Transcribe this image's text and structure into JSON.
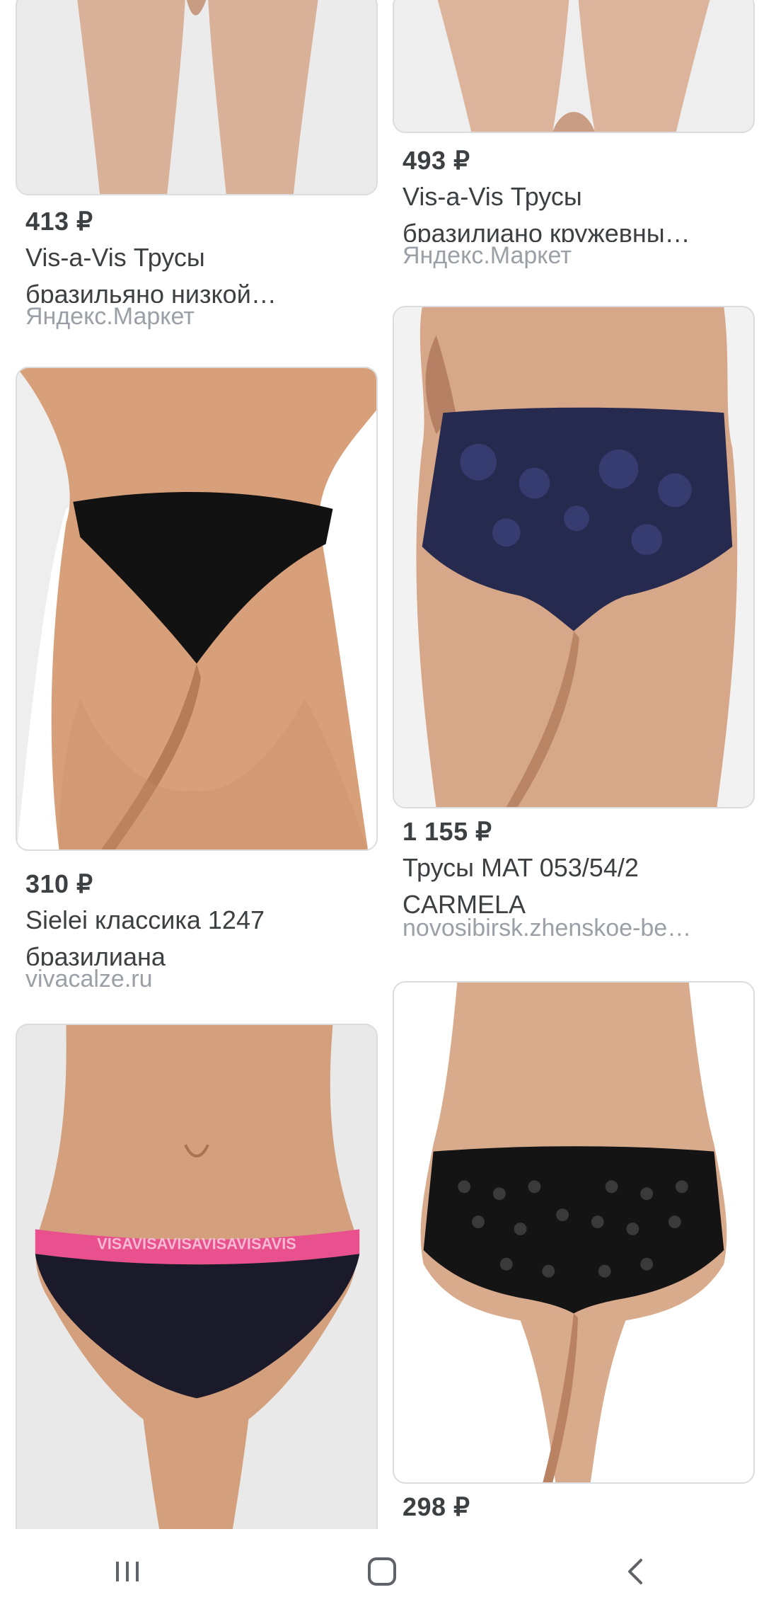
{
  "products": [
    {
      "price": "413 ₽",
      "title_line1": "Vis-a-Vis Трусы",
      "title_line2": "бразильяно низкой…",
      "source": "Яндекс.Маркет",
      "image": "cream-brazilian-front"
    },
    {
      "price": "493 ₽",
      "title_line1": "Vis-a-Vis Трусы",
      "title_line2": "бразилиано кружевны…",
      "source": "Яндекс.Маркет",
      "image": "lace-brazilian-back"
    },
    {
      "price": "310 ₽",
      "title_line1": "Sielei классика 1247",
      "title_line2": "бразилиана",
      "source": "vivacalze.ru",
      "image": "black-brazilian-back"
    },
    {
      "price": "1 155 ₽",
      "title_line1": "Трусы MAT 053/54/2",
      "title_line2": "CARMELA",
      "source": "novosibirsk.zhenskoe-be…",
      "image": "navy-lace-back"
    },
    {
      "price": "",
      "title_line1": "",
      "title_line2": "",
      "source": "",
      "image": "black-pink-waistband-front",
      "waistband_text": "VISAVISAVISAVISAVISAVIS"
    },
    {
      "price": "298 ₽",
      "title_line1": "",
      "title_line2": "",
      "source": "",
      "image": "black-dot-lace-back"
    }
  ],
  "navbar": {
    "recents_icon": "recents-icon",
    "home_icon": "home-icon",
    "back_icon": "back-icon"
  },
  "colors": {
    "skin": "#dcae8f",
    "skin_shadow": "#c28e6e",
    "navy": "#262a4f",
    "black": "#141414",
    "pink": "#e8508e",
    "background": "#ececec"
  }
}
